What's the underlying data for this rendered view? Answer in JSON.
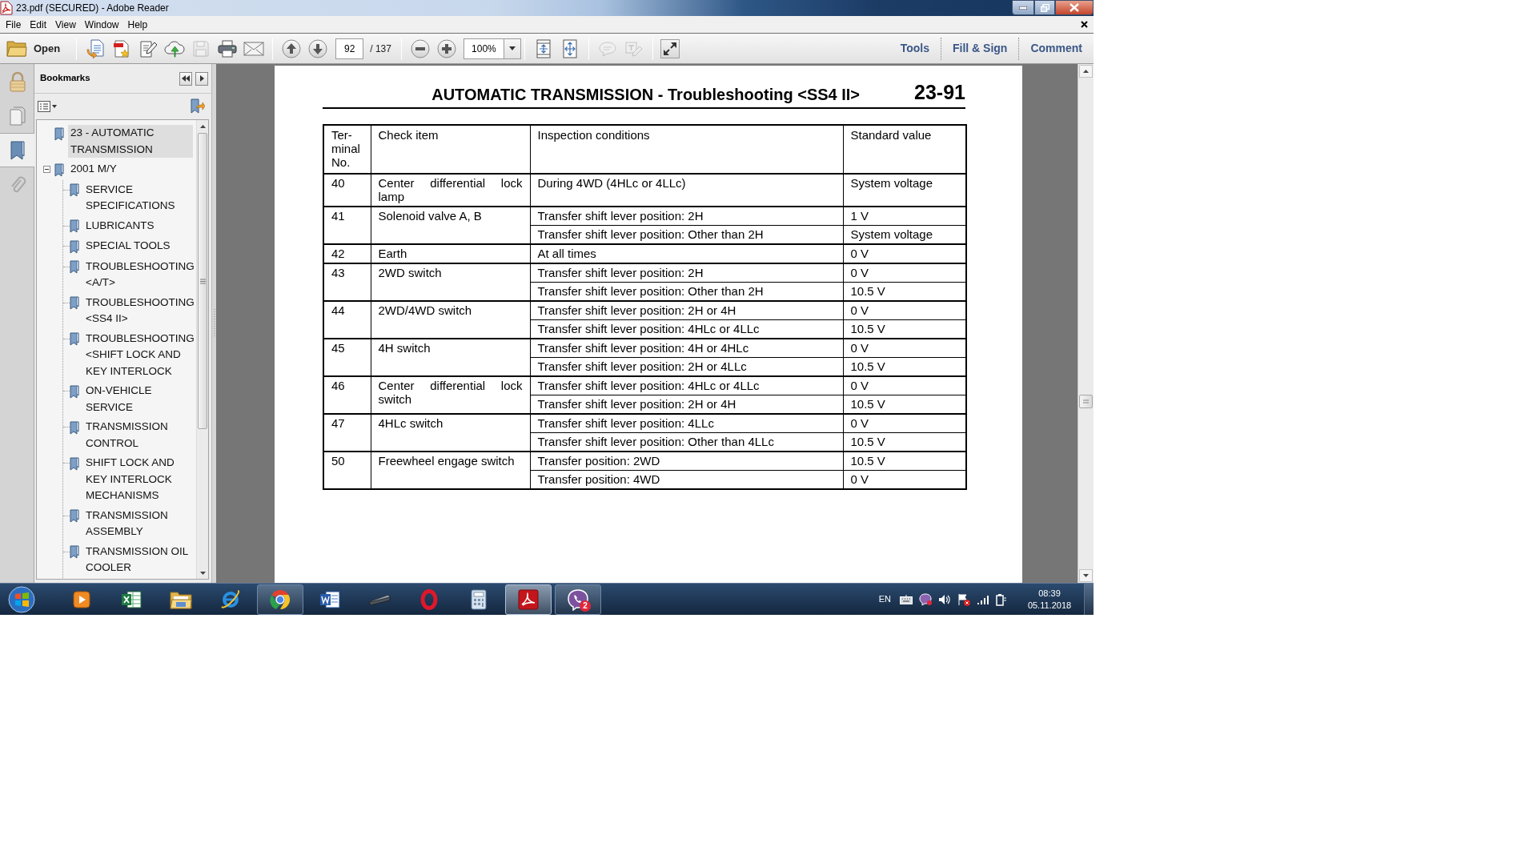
{
  "window": {
    "title": "23.pdf (SECURED) - Adobe Reader"
  },
  "menu": [
    "File",
    "Edit",
    "View",
    "Window",
    "Help"
  ],
  "toolbar": {
    "open": {
      "label": "Open"
    },
    "file_buttons": [
      {
        "kind": "create",
        "disabled": false
      },
      {
        "kind": "convert",
        "disabled": false
      },
      {
        "kind": "sign",
        "disabled": false
      },
      {
        "kind": "upload",
        "disabled": false
      },
      {
        "kind": "save",
        "disabled": true
      },
      {
        "kind": "print",
        "disabled": false
      },
      {
        "kind": "email",
        "disabled": false
      }
    ],
    "page_field": {
      "value": "92"
    },
    "page_total": "/ 137",
    "zoom_field": {
      "value": "100%"
    },
    "view_buttons": [
      {
        "kind": "fit_page",
        "disabled": false
      },
      {
        "kind": "fit_width",
        "disabled": false
      }
    ],
    "comment_buttons": [
      {
        "kind": "comment",
        "disabled": true
      },
      {
        "kind": "text_edit",
        "disabled": true
      }
    ],
    "mode_buttons": [
      {
        "kind": "fullscreen",
        "disabled": false
      }
    ],
    "panes": [
      {
        "label": "Tools"
      },
      {
        "label": "Fill & Sign"
      },
      {
        "label": "Comment"
      }
    ]
  },
  "nav_tabs": [
    {
      "kind": "lock",
      "selected": false
    },
    {
      "kind": "pages",
      "selected": false
    },
    {
      "kind": "bookmarks",
      "selected": true
    },
    {
      "kind": "attachments",
      "selected": false
    }
  ],
  "bookmarks": {
    "title": "Bookmarks",
    "items": [
      {
        "label": "23 - AUTOMATIC TRANSMISSION",
        "selected": true
      },
      {
        "label": "2001 M/Y",
        "selected": false,
        "expanded": true,
        "children": [
          {
            "label": "SERVICE SPECIFICATIONS",
            "selected": false
          },
          {
            "label": "LUBRICANTS",
            "selected": false
          },
          {
            "label": "SPECIAL TOOLS",
            "selected": false
          },
          {
            "label": "TROUBLESHOOTING <A/T>",
            "selected": false
          },
          {
            "label": "TROUBLESHOOTING <SS4 II>",
            "selected": false
          },
          {
            "label": "TROUBLESHOOTING <SHIFT LOCK AND KEY INTERLOCK",
            "selected": false
          },
          {
            "label": "ON-VEHICLE SERVICE",
            "selected": false
          },
          {
            "label": "TRANSMISSION CONTROL",
            "selected": false
          },
          {
            "label": "SHIFT LOCK AND KEY INTERLOCK MECHANISMS",
            "selected": false
          },
          {
            "label": "TRANSMISSION ASSEMBLY",
            "selected": false
          },
          {
            "label": "TRANSMISSION OIL COOLER",
            "selected": false
          }
        ]
      }
    ]
  },
  "document": {
    "header": {
      "title": "AUTOMATIC TRANSMISSION - Troubleshooting <SS4 II>",
      "page_label": "23-91"
    },
    "table": {
      "columns": [
        "Ter-minal No.",
        "Check item",
        "Inspection conditions",
        "Standard value"
      ],
      "rows": [
        {
          "terminal": "40",
          "check_item": "Center differential lock lamp",
          "conditions": [
            {
              "condition": "During 4WD (4HLc or 4LLc)",
              "value": "System voltage"
            }
          ]
        },
        {
          "terminal": "41",
          "check_item": "Solenoid valve A, B",
          "conditions": [
            {
              "condition": "Transfer shift lever position: 2H",
              "value": "1 V"
            },
            {
              "condition": "Transfer shift lever position: Other than 2H",
              "value": "System voltage"
            }
          ]
        },
        {
          "terminal": "42",
          "check_item": "Earth",
          "conditions": [
            {
              "condition": "At all times",
              "value": "0 V"
            }
          ]
        },
        {
          "terminal": "43",
          "check_item": "2WD switch",
          "conditions": [
            {
              "condition": "Transfer shift lever position: 2H",
              "value": "0 V"
            },
            {
              "condition": "Transfer shift lever position: Other than 2H",
              "value": "10.5 V"
            }
          ]
        },
        {
          "terminal": "44",
          "check_item": "2WD/4WD switch",
          "conditions": [
            {
              "condition": "Transfer shift lever position: 2H or 4H",
              "value": "0 V"
            },
            {
              "condition": "Transfer shift lever position: 4HLc or 4LLc",
              "value": "10.5 V"
            }
          ]
        },
        {
          "terminal": "45",
          "check_item": "4H switch",
          "conditions": [
            {
              "condition": "Transfer shift lever position: 4H or 4HLc",
              "value": "0 V"
            },
            {
              "condition": "Transfer shift lever position: 2H or 4LLc",
              "value": "10.5 V"
            }
          ]
        },
        {
          "terminal": "46",
          "check_item": "Center differential lock switch",
          "conditions": [
            {
              "condition": "Transfer shift lever position: 4HLc or 4LLc",
              "value": "0 V"
            },
            {
              "condition": "Transfer shift lever position: 2H or 4H",
              "value": "10.5 V"
            }
          ]
        },
        {
          "terminal": "47",
          "check_item": "4HLc switch",
          "conditions": [
            {
              "condition": "Transfer shift lever position: 4LLc",
              "value": "0 V"
            },
            {
              "condition": "Transfer shift lever position: Other than 4LLc",
              "value": "10.5 V"
            }
          ]
        },
        {
          "terminal": "50",
          "check_item": "Freewheel engage switch",
          "conditions": [
            {
              "condition": "Transfer position: 2WD",
              "value": "10.5 V"
            },
            {
              "condition": "Transfer position: 4WD",
              "value": "0 V"
            }
          ]
        }
      ]
    }
  },
  "taskbar": {
    "apps": [
      {
        "kind": "media",
        "running": false,
        "selected": false
      },
      {
        "kind": "spreadsheet",
        "running": false,
        "selected": false
      },
      {
        "kind": "folder",
        "running": false,
        "selected": false
      },
      {
        "kind": "ie",
        "running": false,
        "selected": false
      },
      {
        "kind": "chrome",
        "running": true,
        "selected": false
      },
      {
        "kind": "word",
        "running": false,
        "selected": false
      },
      {
        "kind": "scanner",
        "running": false,
        "selected": false
      },
      {
        "kind": "opera",
        "running": false,
        "selected": false
      },
      {
        "kind": "calculator",
        "running": false,
        "selected": false
      },
      {
        "kind": "acrobat",
        "running": true,
        "selected": true
      },
      {
        "kind": "viber",
        "running": true,
        "selected": false,
        "badge": "2"
      }
    ],
    "tray": {
      "language": "EN",
      "time": "08:39",
      "date": "05.11.2018"
    }
  }
}
